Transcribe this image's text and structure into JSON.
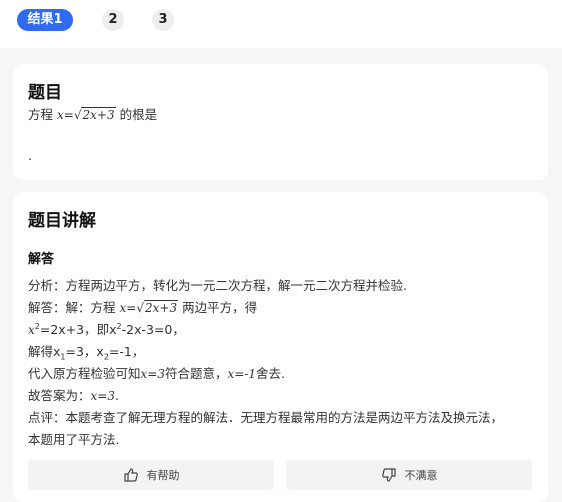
{
  "tabs": [
    {
      "label": "结果1",
      "active": true
    },
    {
      "label": "2",
      "active": false
    },
    {
      "label": "3",
      "active": false
    }
  ],
  "question": {
    "title": "题目",
    "prefix": "方程",
    "eq_lhs": "x=",
    "radical": "2x+3",
    "suffix": "的根是",
    "blank": "."
  },
  "explanation": {
    "title": "题目讲解",
    "answer_heading": "解答",
    "l1": "分析：方程两边平方，转化为一元二次方程，解一元二次方程并检验.",
    "l2_prefix": "解答：解：方程",
    "l2_eq": "x=",
    "l2_radical": "2x+3",
    "l2_suffix": "两边平方，得",
    "l3_a": "x",
    "l3_a_sup": "2",
    "l3_b": "=2x+3，即x",
    "l3_b_sup": "2",
    "l3_c": "-2x-3=0，",
    "l4_a": "解得x",
    "l4_sub1": "1",
    "l4_b": "=3，x",
    "l4_sub2": "2",
    "l4_c": "=-1，",
    "l5_a": "代入原方程检验可知",
    "l5_b": "x=3",
    "l5_c": "符合题意，",
    "l5_d": "x=-1",
    "l5_e": "舍去.",
    "l6_a": "故答案为：",
    "l6_b": "x=3",
    "l6_c": ".",
    "l7": "点评：本题考查了解无理方程的解法．无理方程最常用的方法是两边平方法及换元法，",
    "l8": "本题用了平方法."
  },
  "feedback": {
    "helpful": "有帮助",
    "unsatisfied": "不满意",
    "helpful_icon": "thumbs-up-icon",
    "unsatisfied_icon": "thumbs-down-icon"
  },
  "colors": {
    "accent": "#2f6bf0",
    "page_bg": "#f5f6f8"
  }
}
